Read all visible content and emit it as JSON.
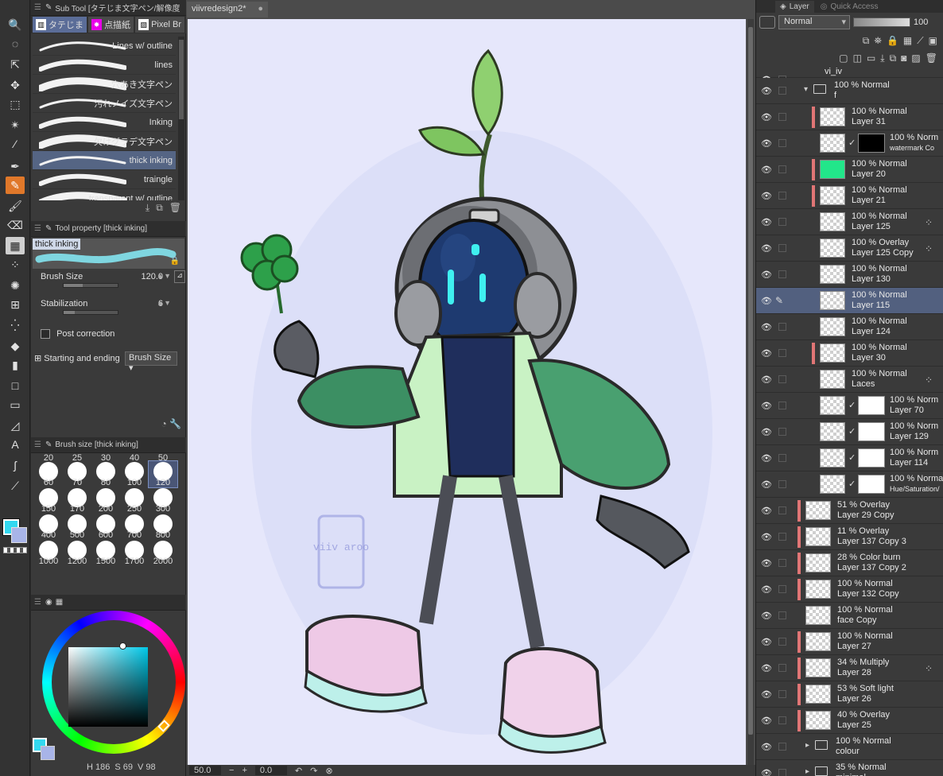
{
  "tools": [
    {
      "name": "zoom-tool",
      "glyph": "🔍"
    },
    {
      "name": "rotate-view-tool",
      "glyph": "◌"
    },
    {
      "name": "object-select-tool",
      "glyph": "⇱"
    },
    {
      "name": "move-layer-tool",
      "glyph": "✥"
    },
    {
      "name": "selection-tool",
      "glyph": "⬚"
    },
    {
      "name": "auto-select-tool",
      "glyph": "✴"
    },
    {
      "name": "eyedropper-tool",
      "glyph": "⁄"
    },
    {
      "name": "pen-tool",
      "glyph": "✒"
    },
    {
      "name": "pencil-tool",
      "glyph": "✎"
    },
    {
      "name": "brush-tool",
      "glyph": "🖌"
    },
    {
      "name": "eraser-tool",
      "glyph": "⌫"
    },
    {
      "name": "decoration-tool",
      "glyph": "▦"
    },
    {
      "name": "airbrush-tool",
      "glyph": "⁘"
    },
    {
      "name": "pattern-tool",
      "glyph": "✺"
    },
    {
      "name": "figure-tool",
      "glyph": "⊞"
    },
    {
      "name": "spray-tool",
      "glyph": "⁛"
    },
    {
      "name": "fill-tool",
      "glyph": "◆"
    },
    {
      "name": "gradient-tool",
      "glyph": "▮"
    },
    {
      "name": "rectangle-tool",
      "glyph": "□"
    },
    {
      "name": "frame-tool",
      "glyph": "▭"
    },
    {
      "name": "ruler-tool",
      "glyph": "◿"
    },
    {
      "name": "text-tool",
      "glyph": "A"
    },
    {
      "name": "balloon-tool",
      "glyph": "ʃ"
    },
    {
      "name": "correct-line-tool",
      "glyph": "⟋"
    }
  ],
  "subtool": {
    "title": "Sub Tool [タテじま文字ペン/解像度",
    "tabs": [
      {
        "label": "タテじま",
        "icon": "▥"
      },
      {
        "label": "点描紙",
        "icon": "✸"
      },
      {
        "label": "Pixel Br",
        "icon": "▨"
      }
    ],
    "brushes": [
      "Lines w/ outline",
      "lines",
      "穴あき文字ペン",
      "汚れノイズ文字ペン",
      "Inking",
      "欠けグラデ文字ペン",
      "thick inking",
      "traingle",
      "transparent w/ outline"
    ]
  },
  "toolprop": {
    "title": "Tool property [thick inking]",
    "preview_label": "thick inking",
    "brush_size_label": "Brush Size",
    "brush_size_value": "120.0",
    "brush_size_fill": 0.35,
    "stabilization_label": "Stabilization",
    "stabilization_value": "6",
    "stabilization_fill": 0.2,
    "post_correction_label": "Post correction",
    "starting_ending_label": "Starting and ending",
    "starting_ending_value": "Brush Size"
  },
  "brushsize": {
    "title": "Brush size [thick inking]",
    "top_values": [
      "20",
      "25",
      "30",
      "40",
      "50"
    ],
    "values": [
      "60",
      "70",
      "80",
      "100",
      "120",
      "150",
      "170",
      "200",
      "250",
      "300",
      "400",
      "500",
      "600",
      "700",
      "800",
      "1000",
      "1200",
      "1500",
      "1700",
      "2000"
    ],
    "selected": "120"
  },
  "color": {
    "main": "#33d8f0",
    "sub": "#a8b4e8",
    "h": "186",
    "s": "69",
    "v": "98"
  },
  "canvas": {
    "doc_title": "viivredesign2*",
    "watermark_text": "viiv aroo",
    "zoom": "50.0",
    "rotation": "0.0"
  },
  "layers_panel": {
    "tab_layer": "Layer",
    "tab_quick": "Quick Access",
    "blend": "Normal",
    "opacity": "100",
    "rows": [
      {
        "t1": "vi_iv",
        "t2": "",
        "kind": "folder-top"
      },
      {
        "t1": "100 % Normal",
        "t2": "f",
        "kind": "folder"
      },
      {
        "t1": "100 % Normal",
        "t2": "Layer 31",
        "clip": true,
        "thumb": "dot"
      },
      {
        "t1": "100 % Norm",
        "t2": "watermark Co",
        "mask": "dark",
        "small": true
      },
      {
        "t1": "100 % Normal",
        "t2": "Layer 20",
        "clip": true,
        "thumb": "green"
      },
      {
        "t1": "100 % Normal",
        "t2": "Layer 21",
        "clip": true,
        "thumb": "dot"
      },
      {
        "t1": "100 % Normal",
        "t2": "Layer 125",
        "ref": true
      },
      {
        "t1": "100 % Overlay",
        "t2": "Layer 125 Copy",
        "ref": true
      },
      {
        "t1": "100 % Normal",
        "t2": "Layer 130"
      },
      {
        "t1": "100 % Normal",
        "t2": "Layer 115",
        "selected": true,
        "pen": true
      },
      {
        "t1": "100 % Normal",
        "t2": "Layer 124"
      },
      {
        "t1": "100 % Normal",
        "t2": "Layer 30",
        "clip": true
      },
      {
        "t1": "100 % Normal",
        "t2": "Laces",
        "ref": true
      },
      {
        "t1": "100 % Norm",
        "t2": "Layer 70",
        "mask": "white"
      },
      {
        "t1": "100 % Norm",
        "t2": "Layer 129",
        "mask": "white"
      },
      {
        "t1": "100 % Norm",
        "t2": "Layer 114",
        "mask": "white"
      },
      {
        "t1": "100 % Normal",
        "t2": "Hue/Saturation/",
        "kind": "correction",
        "small": true
      },
      {
        "t1": "51 % Overlay",
        "t2": "Layer 29 Copy",
        "clip": true,
        "level": 1
      },
      {
        "t1": "11 % Overlay",
        "t2": "Layer 137 Copy 3",
        "clip": true,
        "level": 1
      },
      {
        "t1": "28 % Color burn",
        "t2": "Layer 137 Copy 2",
        "clip": true,
        "level": 1
      },
      {
        "t1": "100 % Normal",
        "t2": "Layer 132 Copy",
        "clip": true,
        "level": 1
      },
      {
        "t1": "100 % Normal",
        "t2": "face Copy",
        "level": 1
      },
      {
        "t1": "100 % Normal",
        "t2": "Layer 27",
        "clip": true,
        "level": 1
      },
      {
        "t1": "34 % Multiply",
        "t2": "Layer 28",
        "clip": true,
        "level": 1,
        "ref": true
      },
      {
        "t1": "53 % Soft light",
        "t2": "Layer 26",
        "clip": true,
        "level": 1
      },
      {
        "t1": "40 % Overlay",
        "t2": "Layer 25",
        "clip": true,
        "level": 1
      },
      {
        "t1": "100 % Normal",
        "t2": "colour",
        "kind": "subfolder"
      },
      {
        "t1": "35 % Normal",
        "t2": "minimal",
        "kind": "subfolder"
      }
    ]
  }
}
